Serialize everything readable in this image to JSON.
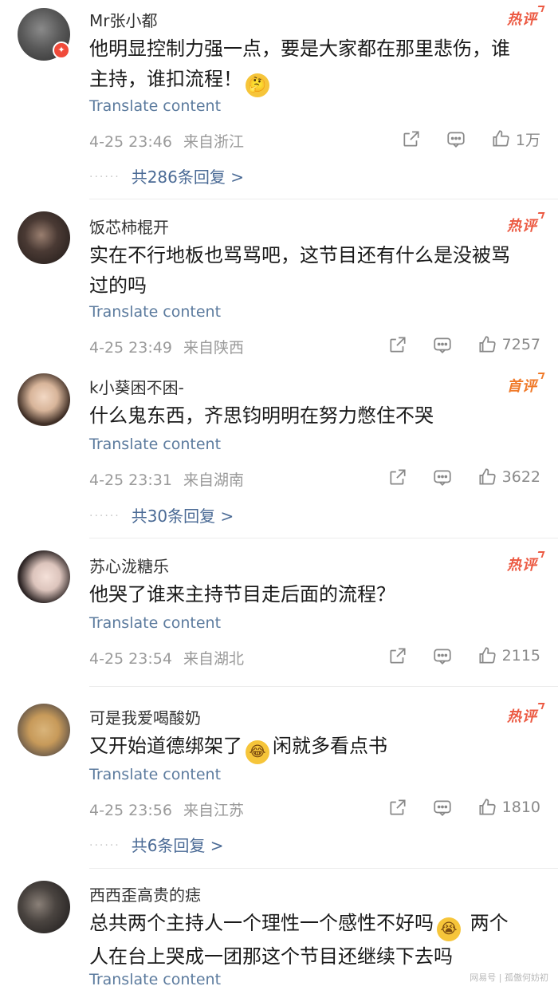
{
  "translate_label": "Translate content",
  "watermark": "网易号 | 孤傲何妨初",
  "comments": [
    {
      "username": "Mr张小都",
      "tag": "热评",
      "text": "他明显控制力强一点，要是大家都在那里悲伤，谁主持，谁扣流程！",
      "emoji": "thinking-face-emoji",
      "time": "4-25 23:46",
      "location": "来自浙江",
      "likes": "1万",
      "replies": "共286条回复 >",
      "avatar_color": "#5a5a5a"
    },
    {
      "username": "饭芯柿棍开",
      "tag": "热评",
      "text": "实在不行地板也骂骂吧，这节目还有什么是没被骂过的吗",
      "time": "4-25 23:49",
      "location": "来自陕西",
      "likes": "7257",
      "avatar_color": "#3a3230"
    },
    {
      "username": "k小葵困不困-",
      "tag": "首评",
      "text": "什么鬼东西，齐思钧明明在努力憋住不哭",
      "time": "4-25 23:31",
      "location": "来自湖南",
      "likes": "3622",
      "replies": "共30条回复 >",
      "avatar_color": "#c9b8a8"
    },
    {
      "username": "苏心泷糖乐",
      "tag": "热评",
      "text": "他哭了谁来主持节目走后面的流程？",
      "time": "4-25 23:54",
      "location": "来自湖北",
      "likes": "2115",
      "avatar_color": "#d8c8c4"
    },
    {
      "username": "可是我爱喝酸奶",
      "tag": "热评",
      "text_before": "又开始道德绑架了",
      "emoji": "laughing-tears-emoji",
      "text_after": "闲就多看点书",
      "time": "4-25 23:56",
      "location": "来自江苏",
      "likes": "1810",
      "replies": "共6条回复 >",
      "avatar_color": "#c9a46a"
    },
    {
      "username": "西西歪高贵的痣",
      "text_before": "总共两个主持人一个理性一个感性不好吗",
      "emoji": "crying-face-emoji",
      "text_after": " 两个人在台上哭成一团那这个节目还继续下去吗",
      "avatar_color": "#2e2e2e"
    }
  ]
}
